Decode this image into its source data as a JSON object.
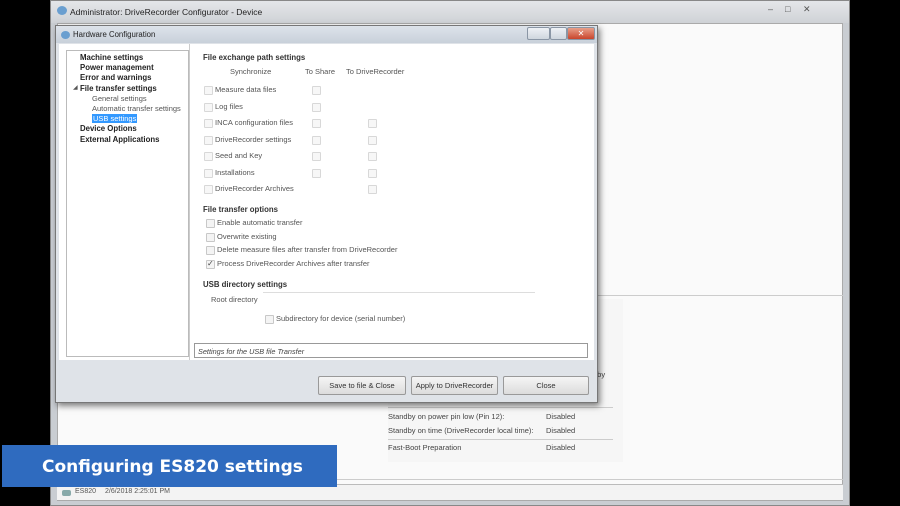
{
  "main_window": {
    "title": "Administrator: DriveRecorder Configurator - Device",
    "controls": {
      "minimize": "–",
      "maximize": "□",
      "close": "✕"
    },
    "background_panel": {
      "partial_text": "dby",
      "rows": [
        {
          "label": "Standby on power pin low (Pin 12):",
          "value": "Disabled"
        },
        {
          "label": "Standby on time (DriveRecorder local time):",
          "value": "Disabled"
        },
        {
          "label": "Fast-Boot Preparation",
          "value": "Disabled"
        }
      ]
    },
    "status_bar": {
      "device": "ES820",
      "timestamp": "2/6/2018 2:25:01 PM"
    }
  },
  "dialog": {
    "title": "Hardware Configuration",
    "tree": {
      "items": [
        {
          "label": "Machine settings",
          "level": 0
        },
        {
          "label": "Power management",
          "level": 0
        },
        {
          "label": "Error and warnings",
          "level": 0
        },
        {
          "label": "File transfer settings",
          "level": 0,
          "expanded": true
        },
        {
          "label": "General settings",
          "level": 1
        },
        {
          "label": "Automatic transfer settings",
          "level": 1
        },
        {
          "label": "USB settings",
          "level": 1,
          "selected": true
        },
        {
          "label": "Device Options",
          "level": 0
        },
        {
          "label": "External Applications",
          "level": 0
        }
      ]
    },
    "exchange": {
      "heading": "File exchange path settings",
      "columns": [
        "Synchronize",
        "To Share",
        "To DriveRecorder"
      ],
      "rows": [
        {
          "label": "Measure data files",
          "share": true,
          "dr": false
        },
        {
          "label": "Log files",
          "share": true,
          "dr": false
        },
        {
          "label": "INCA configuration files",
          "share": true,
          "dr": true
        },
        {
          "label": "DriveRecorder settings",
          "share": true,
          "dr": true
        },
        {
          "label": "Seed and Key",
          "share": true,
          "dr": true
        },
        {
          "label": "Installations",
          "share": true,
          "dr": true
        },
        {
          "label": "DriveRecorder Archives",
          "share": false,
          "dr": true
        }
      ]
    },
    "transfer": {
      "heading": "File transfer options",
      "options": [
        {
          "label": "Enable automatic transfer",
          "checked": false
        },
        {
          "label": "Overwrite existing",
          "checked": false
        },
        {
          "label": "Delete measure files after transfer from DriveRecorder",
          "checked": false
        },
        {
          "label": "Process DriveRecorder Archives after transfer",
          "checked": true
        }
      ]
    },
    "usb": {
      "heading": "USB directory settings",
      "root_label": "Root directory",
      "root_value": "",
      "subdir_label": "Subdirectory for device (serial number)",
      "subdir_checked": false
    },
    "description": "Settings for the USB file Transfer",
    "buttons": {
      "save": "Save to file & Close",
      "apply": "Apply to DriveRecorder",
      "close": "Close"
    }
  },
  "overlay": {
    "caption": "Configuring ES820 settings"
  },
  "colors": {
    "selection": "#3399ff",
    "banner": "#2f6bbf"
  }
}
